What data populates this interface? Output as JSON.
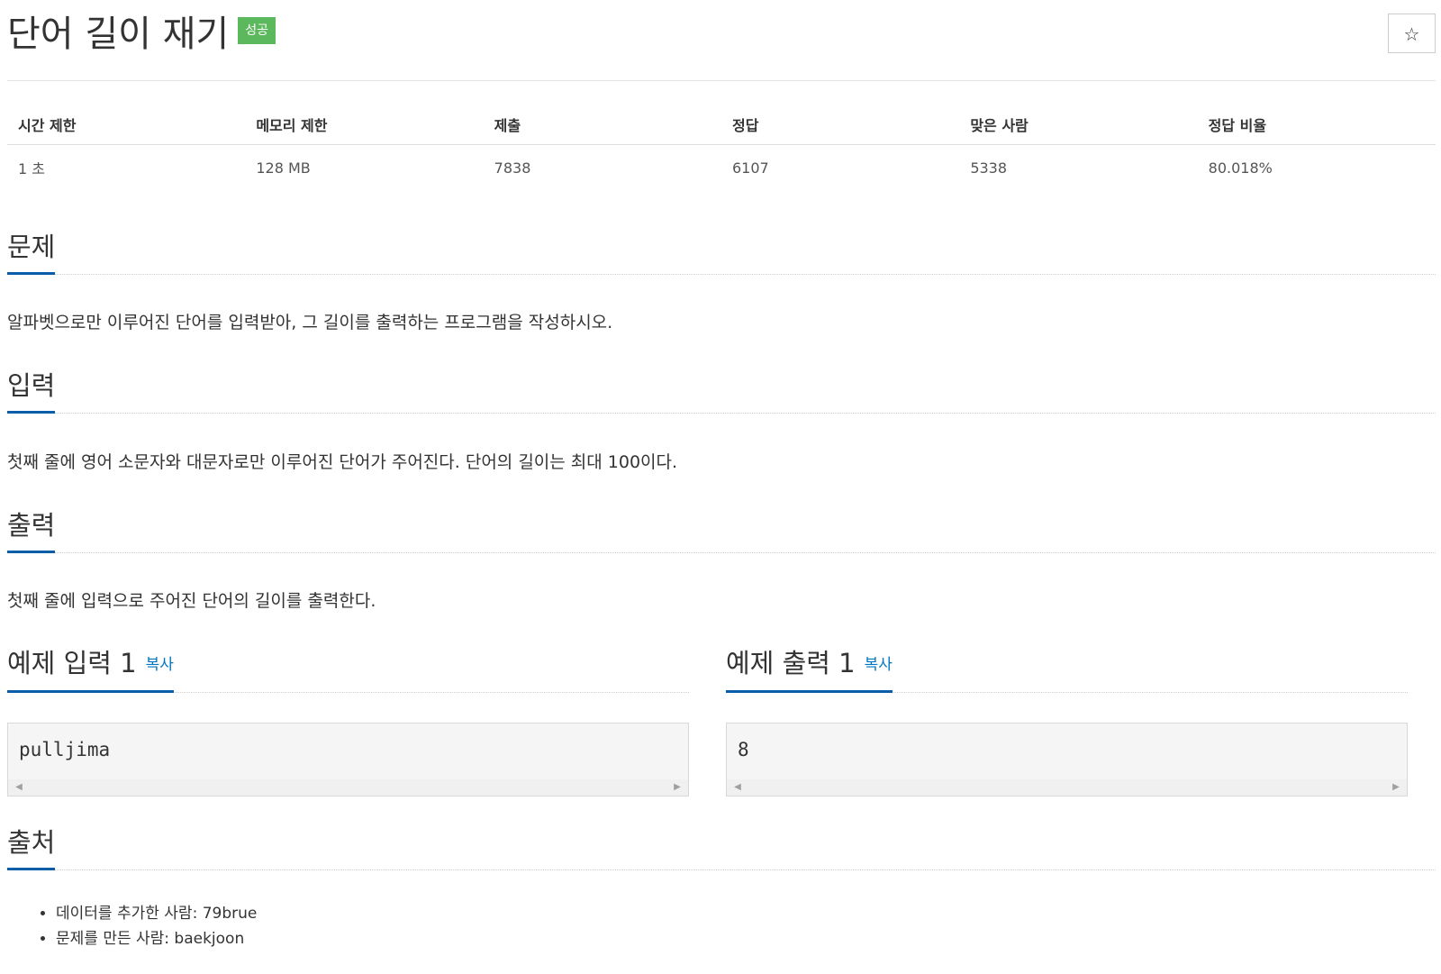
{
  "problem": {
    "title": "단어 길이 재기",
    "result_badge": "성공",
    "star_icon": "☆"
  },
  "info_table": {
    "headers": [
      "시간 제한",
      "메모리 제한",
      "제출",
      "정답",
      "맞은 사람",
      "정답 비율"
    ],
    "values": [
      "1 초",
      "128 MB",
      "7838",
      "6107",
      "5338",
      "80.018%"
    ]
  },
  "sections": {
    "description": {
      "title": "문제",
      "text": "알파벳으로만 이루어진 단어를 입력받아, 그 길이를 출력하는 프로그램을 작성하시오."
    },
    "input": {
      "title": "입력",
      "text": "첫째 줄에 영어 소문자와 대문자로만 이루어진 단어가 주어진다. 단어의 길이는 최대 100이다."
    },
    "output": {
      "title": "출력",
      "text": "첫째 줄에 입력으로 주어진 단어의 길이를 출력한다."
    }
  },
  "samples": {
    "input": {
      "title": "예제 입력 1",
      "copy_label": "복사",
      "code": "pulljima"
    },
    "output": {
      "title": "예제 출력 1",
      "copy_label": "복사",
      "code": "8"
    }
  },
  "source": {
    "title": "출처",
    "items": [
      "데이터를 추가한 사람: 79brue",
      "문제를 만든 사람: baekjoon"
    ]
  }
}
